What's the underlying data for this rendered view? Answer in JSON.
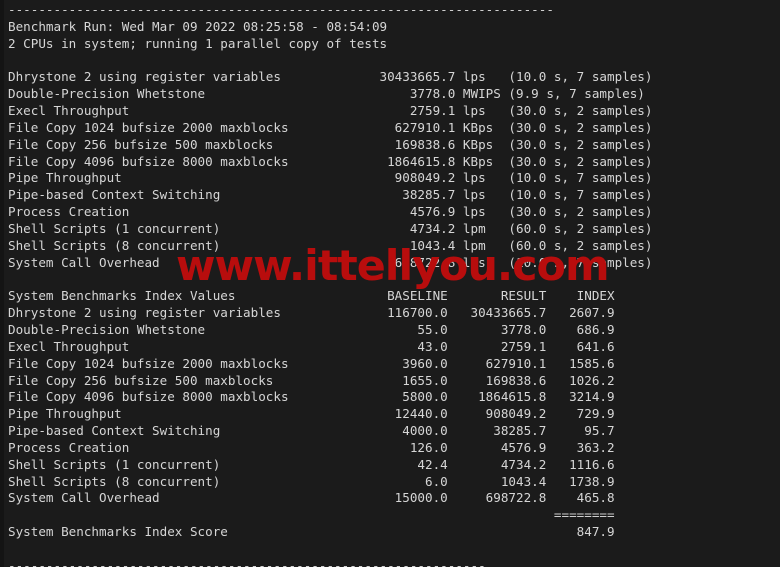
{
  "terminal": {
    "background": "#1b1b1b",
    "foreground": "#d6d6d6",
    "watermark_color": "#b80d0d"
  },
  "watermark": {
    "text": "www.ittellyou.com"
  },
  "rules": {
    "top": "------------------------------------------------------------------------",
    "bottom": "---------------------------------------------------------------",
    "equals": "========"
  },
  "header": {
    "benchmark_run": "Benchmark Run: Wed Mar 09 2022 08:25:58 - 08:54:09",
    "cpu_info": "2 CPUs in system; running 1 parallel copy of tests"
  },
  "results": {
    "rows": [
      {
        "name": "Dhrystone 2 using register variables",
        "value": "30433665.7",
        "unit": "lps",
        "timing": "(10.0 s, 7 samples)"
      },
      {
        "name": "Double-Precision Whetstone",
        "value": "3778.0",
        "unit": "MWIPS",
        "timing": "(9.9 s, 7 samples)"
      },
      {
        "name": "Execl Throughput",
        "value": "2759.1",
        "unit": "lps",
        "timing": "(30.0 s, 2 samples)"
      },
      {
        "name": "File Copy 1024 bufsize 2000 maxblocks",
        "value": "627910.1",
        "unit": "KBps",
        "timing": "(30.0 s, 2 samples)"
      },
      {
        "name": "File Copy 256 bufsize 500 maxblocks",
        "value": "169838.6",
        "unit": "KBps",
        "timing": "(30.0 s, 2 samples)"
      },
      {
        "name": "File Copy 4096 bufsize 8000 maxblocks",
        "value": "1864615.8",
        "unit": "KBps",
        "timing": "(30.0 s, 2 samples)"
      },
      {
        "name": "Pipe Throughput",
        "value": "908049.2",
        "unit": "lps",
        "timing": "(10.0 s, 7 samples)"
      },
      {
        "name": "Pipe-based Context Switching",
        "value": "38285.7",
        "unit": "lps",
        "timing": "(10.0 s, 7 samples)"
      },
      {
        "name": "Process Creation",
        "value": "4576.9",
        "unit": "lps",
        "timing": "(30.0 s, 2 samples)"
      },
      {
        "name": "Shell Scripts (1 concurrent)",
        "value": "4734.2",
        "unit": "lpm",
        "timing": "(60.0 s, 2 samples)"
      },
      {
        "name": "Shell Scripts (8 concurrent)",
        "value": "1043.4",
        "unit": "lpm",
        "timing": "(60.0 s, 2 samples)"
      },
      {
        "name": "System Call Overhead",
        "value": "698722.8",
        "unit": "lps",
        "timing": "(10.0 s, 7 samples)"
      }
    ]
  },
  "index_table": {
    "title": "System Benchmarks Index Values",
    "columns": [
      "BASELINE",
      "RESULT",
      "INDEX"
    ],
    "rows": [
      {
        "name": "Dhrystone 2 using register variables",
        "baseline": "116700.0",
        "result": "30433665.7",
        "index": "2607.9"
      },
      {
        "name": "Double-Precision Whetstone",
        "baseline": "55.0",
        "result": "3778.0",
        "index": "686.9"
      },
      {
        "name": "Execl Throughput",
        "baseline": "43.0",
        "result": "2759.1",
        "index": "641.6"
      },
      {
        "name": "File Copy 1024 bufsize 2000 maxblocks",
        "baseline": "3960.0",
        "result": "627910.1",
        "index": "1585.6"
      },
      {
        "name": "File Copy 256 bufsize 500 maxblocks",
        "baseline": "1655.0",
        "result": "169838.6",
        "index": "1026.2"
      },
      {
        "name": "File Copy 4096 bufsize 8000 maxblocks",
        "baseline": "5800.0",
        "result": "1864615.8",
        "index": "3214.9"
      },
      {
        "name": "Pipe Throughput",
        "baseline": "12440.0",
        "result": "908049.2",
        "index": "729.9"
      },
      {
        "name": "Pipe-based Context Switching",
        "baseline": "4000.0",
        "result": "38285.7",
        "index": "95.7"
      },
      {
        "name": "Process Creation",
        "baseline": "126.0",
        "result": "4576.9",
        "index": "363.2"
      },
      {
        "name": "Shell Scripts (1 concurrent)",
        "baseline": "42.4",
        "result": "4734.2",
        "index": "1116.6"
      },
      {
        "name": "Shell Scripts (8 concurrent)",
        "baseline": "6.0",
        "result": "1043.4",
        "index": "1738.9"
      },
      {
        "name": "System Call Overhead",
        "baseline": "15000.0",
        "result": "698722.8",
        "index": "465.8"
      }
    ]
  },
  "score": {
    "label": "System Benchmarks Index Score",
    "value": "847.9"
  }
}
